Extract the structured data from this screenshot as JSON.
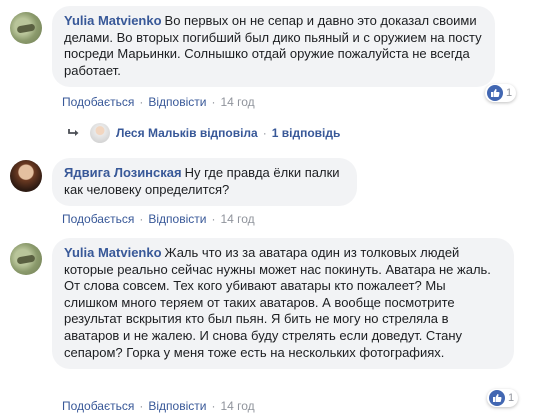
{
  "comments": [
    {
      "author": "Yulia Matvienko",
      "text": "Во первых он не сепар и давно это доказал своими делами. Во вторых погибший был дико пьяный и с оружием на посту посреди Марьинки. Солнышко отдай оружие пожалуйста не всегда работает.",
      "like_label": "Подобається",
      "reply_label": "Відповісти",
      "time": "14 год",
      "reactions": "1"
    },
    {
      "author": "Ядвига Лозинская",
      "text": "Ну где правда ёлки палки как человеку определится?",
      "like_label": "Подобається",
      "reply_label": "Відповісти",
      "time": "14 год"
    },
    {
      "author": "Yulia Matvienko",
      "text": "Жаль что из за аватара один из толковых людей которые реально сейчас нужны может нас покинуть. Аватара не жаль. От слова совсем. Тех кого убивают аватары кто пожалеет? Мы слишком много теряем от таких аватаров. А вообще посмотрите результат вскрытия кто был пьян. Я бить не могу но стреляла в аватаров и не жалею. И снова буду стрелять если доведут. Стану сепаром? Горка у меня тоже есть на нескольких фотографиях.",
      "like_label": "Подобається",
      "reply_label": "Відповісти",
      "time": "14 год",
      "reactions": "1"
    }
  ],
  "reply_summary": {
    "text": "Леся Мальків відповіла",
    "count": "1 відповідь"
  },
  "separator": "·"
}
